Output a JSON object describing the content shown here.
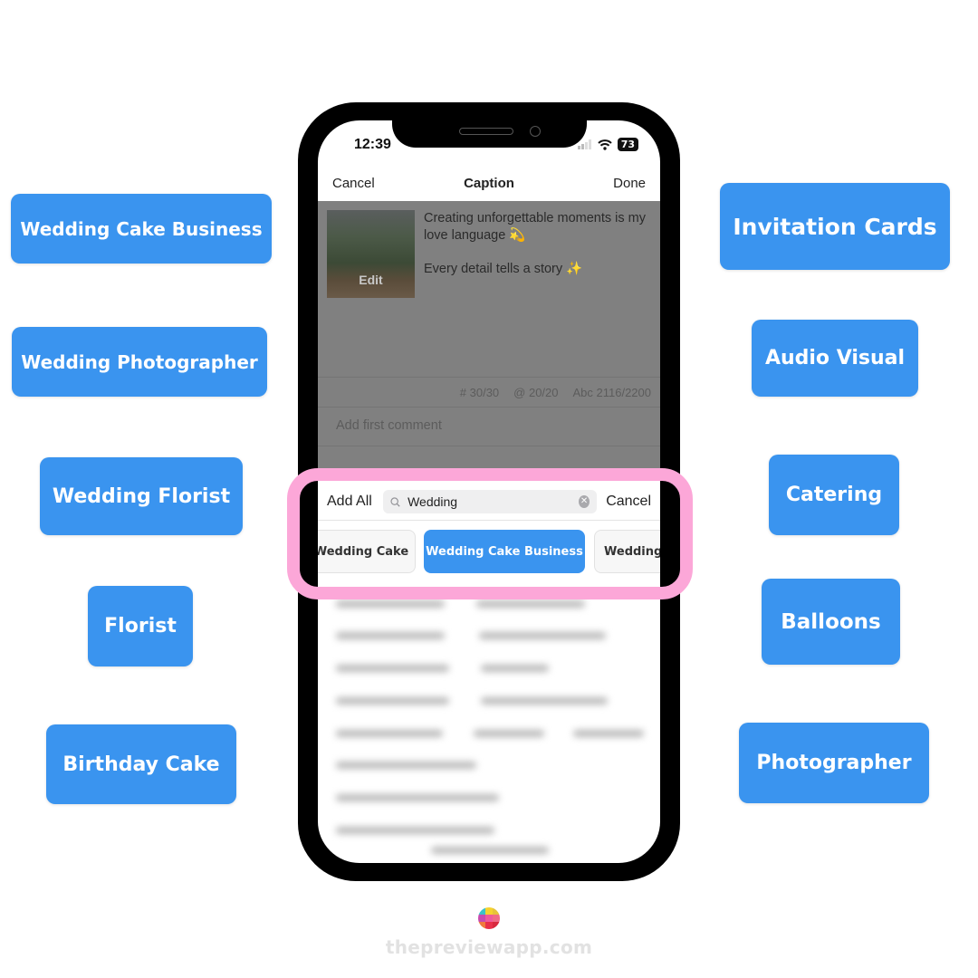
{
  "left_keywords": [
    {
      "label": "Wedding Cake Business"
    },
    {
      "label": "Wedding Photographer"
    },
    {
      "label": "Wedding Florist"
    },
    {
      "label": "Florist"
    },
    {
      "label": "Birthday Cake"
    }
  ],
  "right_keywords": [
    {
      "label": "Invitation Cards"
    },
    {
      "label": "Audio Visual"
    },
    {
      "label": "Catering"
    },
    {
      "label": "Balloons"
    },
    {
      "label": "Photographer"
    }
  ],
  "status_bar": {
    "time": "12:39",
    "battery": "73",
    "wifi_icon": "wifi-icon",
    "signal_icon": "signal-icon"
  },
  "nav": {
    "cancel": "Cancel",
    "title": "Caption",
    "done": "Done"
  },
  "post": {
    "thumbnail_edit": "Edit",
    "caption_line1": "Creating unforgettable moments is my love language 💫",
    "caption_line2": "Every detail tells a story ✨",
    "hashtag_count": "# 30/30",
    "mention_count": "@ 20/20",
    "char_count": "Abc 2116/2200",
    "comment_placeholder": "Add first comment"
  },
  "hashtag_search": {
    "add_all": "Add All",
    "search_value": "Wedding",
    "search_icon": "magnifier",
    "clear_icon": "x-circle",
    "cancel": "Cancel",
    "suggestions": [
      {
        "label": "Wedding Cake",
        "selected": false
      },
      {
        "label": "Wedding Cake Business",
        "selected": true
      },
      {
        "label": "Wedding",
        "selected": false
      }
    ]
  },
  "colors": {
    "accent_blue": "#3a94ef",
    "highlight_pink": "#fca7d8"
  },
  "footer": {
    "brand": "thepreviewapp.com"
  }
}
